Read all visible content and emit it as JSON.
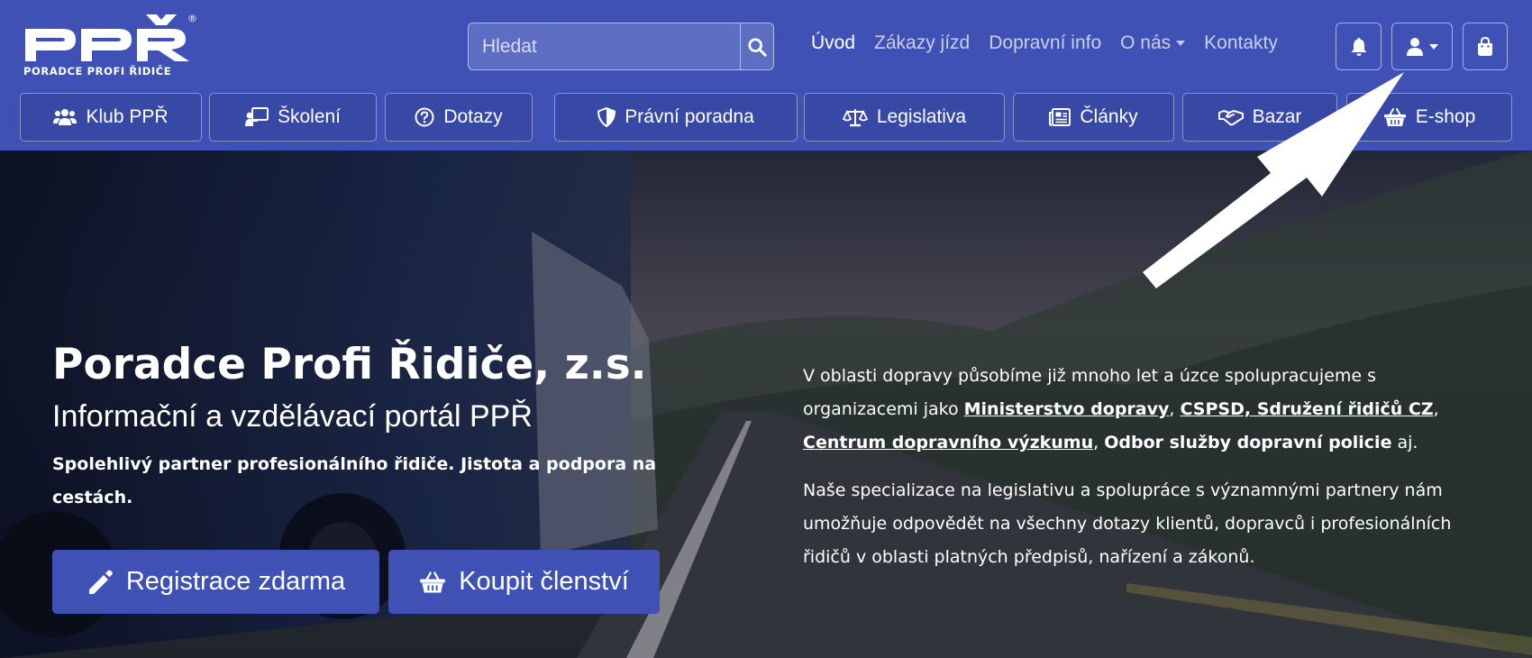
{
  "logo": {
    "mark": "PPŘ",
    "text": "PORADCE PROFI ŘIDIČE",
    "registered": "®"
  },
  "search": {
    "placeholder": "Hledat",
    "icon": "search-icon"
  },
  "topnav": [
    {
      "label": "Úvod",
      "active": true
    },
    {
      "label": "Zákazy jízd"
    },
    {
      "label": "Dopravní info"
    },
    {
      "label": "O nás",
      "dropdown": true
    },
    {
      "label": "Kontakty"
    }
  ],
  "header_icons": [
    "bell-icon",
    "user-icon",
    "shopping-bag-icon"
  ],
  "mainnav": [
    {
      "label": "Klub PPŘ",
      "icon": "users-icon"
    },
    {
      "label": "Školení",
      "icon": "teacher-icon"
    },
    {
      "label": "Dotazy",
      "icon": "question-circle-icon"
    },
    {
      "label": "Právní poradna",
      "icon": "shield-icon"
    },
    {
      "label": "Legislativa",
      "icon": "scales-icon"
    },
    {
      "label": "Články",
      "icon": "newspaper-icon"
    },
    {
      "label": "Bazar",
      "icon": "handshake-icon"
    },
    {
      "label": "E-shop",
      "icon": "basket-icon"
    }
  ],
  "hero": {
    "title": "Poradce Profi Řidiče, z.s.",
    "subtitle": "Informační a vzdělávací portál PPŘ",
    "tagline": "Spolehlivý partner profesionálního řidiče. Jistota a podpora na cestách.",
    "buttons": [
      {
        "label": "Registrace zdarma",
        "icon": "pencil-icon"
      },
      {
        "label": "Koupit členství",
        "icon": "basket-icon"
      }
    ],
    "paragraph1": {
      "intro": "V oblasti dopravy působíme již mnoho let a úzce spolupracujeme s organizacemi jako ",
      "link1": "Ministerstvo dopravy",
      "sep1": ", ",
      "link2": "CSPSD, Sdružení řidičů CZ",
      "sep2": ", ",
      "link3": "Centrum dopravního výzkumu",
      "sep3": ", ",
      "bold": "Odbor služby dopravní policie",
      "outro": " aj."
    },
    "paragraph2": "Naše specializace na legislativu a spolupráce s významnými partnery nám umožňuje odpovědět na všechny dotazy klientů, dopravců i profesionálních řidičů v oblasti platných předpisů, nařízení a zákonů."
  },
  "colors": {
    "brand": "#3f51b5",
    "white": "#ffffff"
  }
}
